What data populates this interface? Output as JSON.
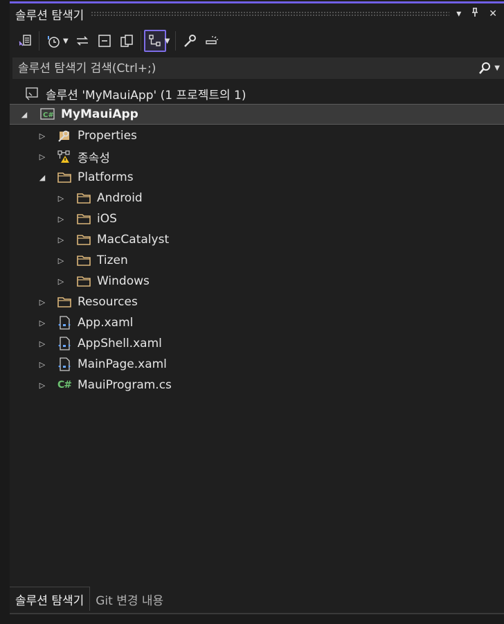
{
  "header": {
    "title": "솔루션 탐색기",
    "menu_icon": "▾",
    "pin_icon": "pin-icon",
    "close_icon": "✕"
  },
  "toolbar": {
    "icons": [
      "vs-switch-views-icon",
      "history-icon",
      "sync-icon",
      "collapse-all-icon",
      "copy-icon",
      "show-all-files-icon",
      "properties-wrench-icon",
      "preview-icon"
    ]
  },
  "search": {
    "placeholder": "솔루션 탐색기 검색(Ctrl+;)"
  },
  "tree": {
    "solution": "솔루션 'MyMauiApp' (1 프로젝트의 1)",
    "project": "MyMauiApp",
    "items": {
      "properties": "Properties",
      "dependencies": "종속성",
      "platforms": "Platforms",
      "android": "Android",
      "ios": "iOS",
      "maccatalyst": "MacCatalyst",
      "tizen": "Tizen",
      "windows": "Windows",
      "resources": "Resources",
      "app_xaml": "App.xaml",
      "appshell_xaml": "AppShell.xaml",
      "mainpage_xaml": "MainPage.xaml",
      "mauiprogram_cs": "MauiProgram.cs"
    },
    "csharp_glyph": "C#"
  },
  "bottom_tabs": {
    "solution_explorer": "솔루션 탐색기",
    "git_changes": "Git 변경 내용"
  },
  "colors": {
    "accent": "#7160e8",
    "background": "#1f1f1f",
    "folder": "#dcb67a",
    "csharp": "#6cc070"
  }
}
